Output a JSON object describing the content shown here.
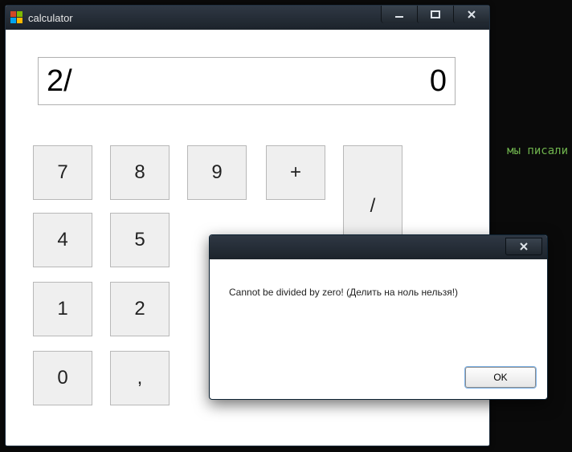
{
  "background_text": "мы писали",
  "window": {
    "title": "calculator",
    "display_expression": "2/",
    "display_result": "0",
    "buttons": {
      "seven": "7",
      "eight": "8",
      "nine": "9",
      "plus": "+",
      "divide": "/",
      "four": "4",
      "five": "5",
      "one": "1",
      "two": "2",
      "zero": "0",
      "comma": ","
    }
  },
  "dialog": {
    "message": "Cannot be divided by zero! (Делить на ноль нельзя!)",
    "ok": "OK"
  }
}
